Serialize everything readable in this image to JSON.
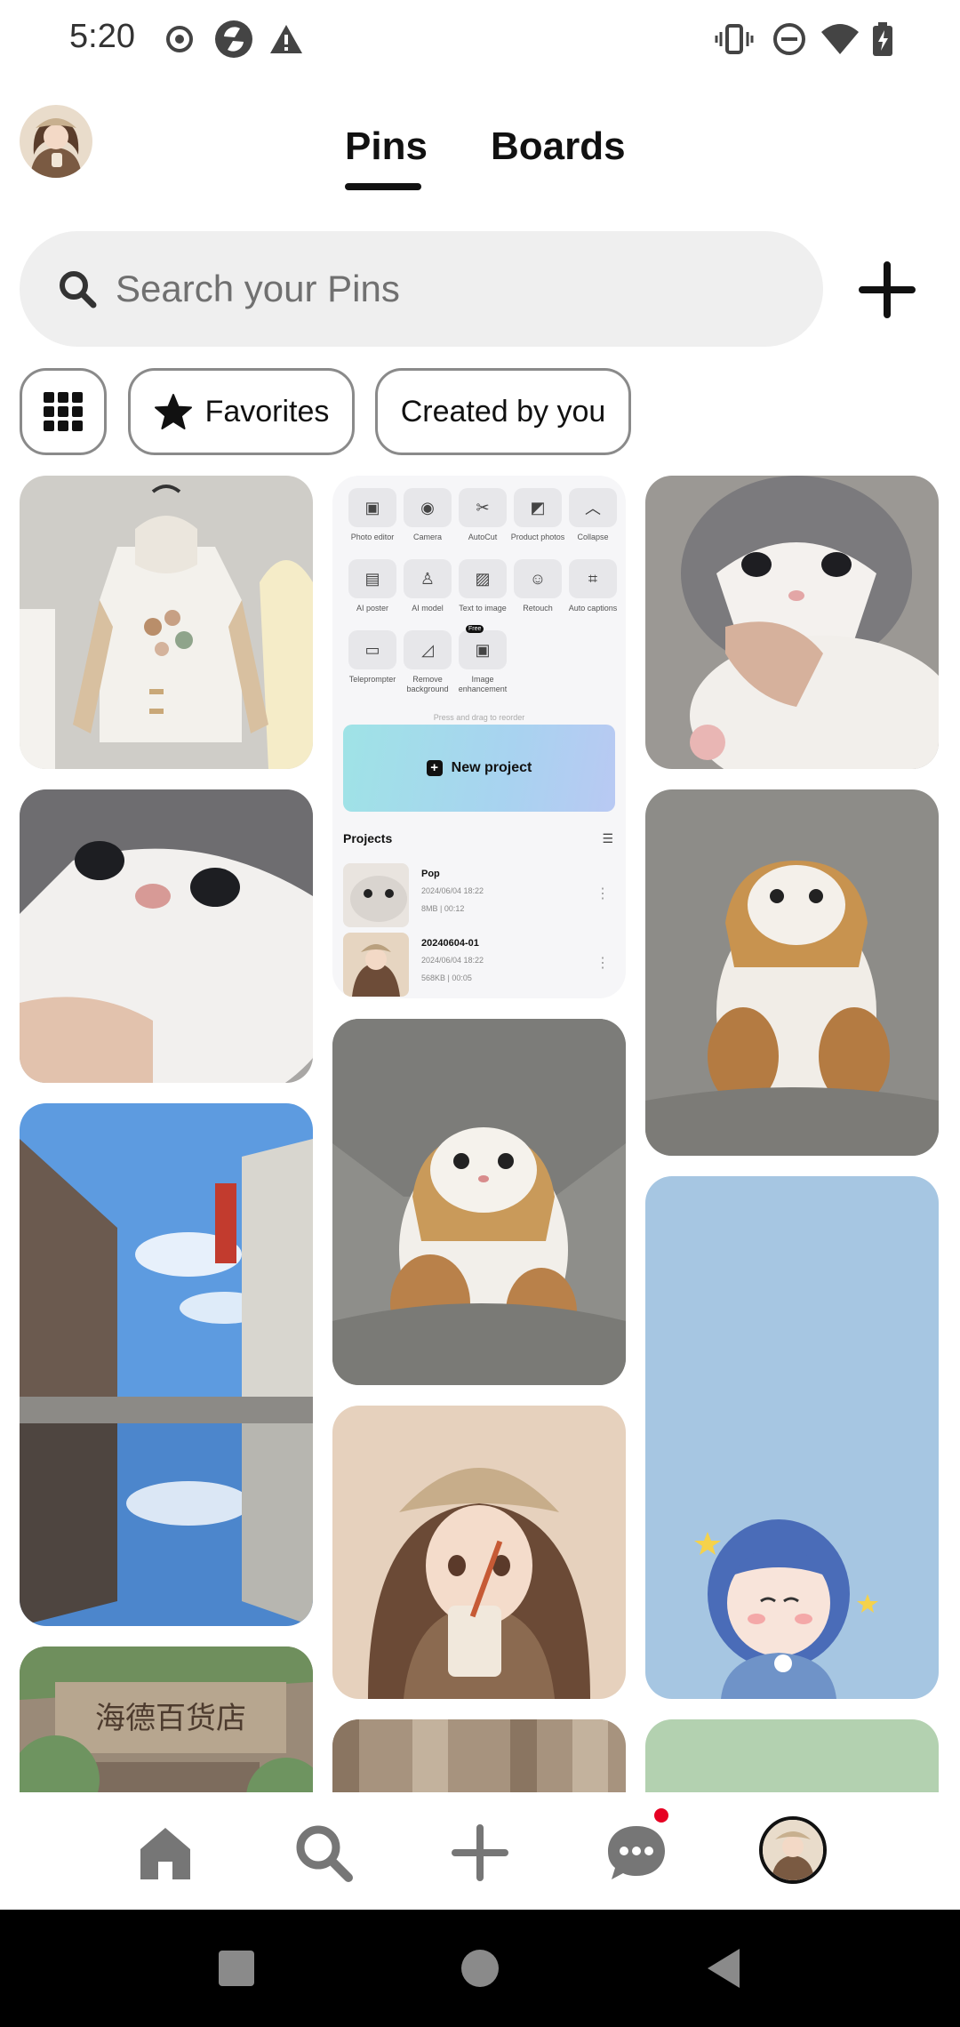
{
  "status_bar": {
    "time": "5:20"
  },
  "header": {
    "tabs": [
      {
        "label": "Pins",
        "active": true
      },
      {
        "label": "Boards",
        "active": false
      }
    ]
  },
  "search": {
    "placeholder": "Search your Pins"
  },
  "filters": [
    {
      "label": "Favorites"
    },
    {
      "label": "Created by you"
    }
  ],
  "editor_screenshot": {
    "tools": [
      {
        "label": "Photo editor"
      },
      {
        "label": "Camera"
      },
      {
        "label": "AutoCut"
      },
      {
        "label": "Product photos"
      },
      {
        "label": "Collapse"
      },
      {
        "label": "AI poster"
      },
      {
        "label": "AI model"
      },
      {
        "label": "Text to image"
      },
      {
        "label": "Retouch"
      },
      {
        "label": "Auto captions"
      },
      {
        "label": "Teleprompter"
      },
      {
        "label": "Remove background"
      },
      {
        "label": "Image enhancement"
      }
    ],
    "free_badge": "Free",
    "hint": "Press and drag to reorder",
    "new_project": "New project",
    "projects_title": "Projects",
    "projects": [
      {
        "name": "Pop",
        "date": "2024/06/04 18:22",
        "meta": "8MB | 00:12"
      },
      {
        "name": "20240604-01",
        "date": "2024/06/04 18:22",
        "meta": "568KB | 00:05"
      }
    ]
  },
  "colors": {
    "accent": "#e60023",
    "chip_border": "#8a8a8a",
    "search_bg": "#efefef"
  },
  "bottom_nav": [
    "home-icon",
    "search-icon",
    "plus-icon",
    "chat-icon",
    "profile-avatar"
  ]
}
